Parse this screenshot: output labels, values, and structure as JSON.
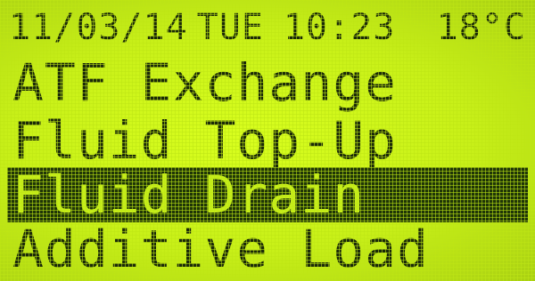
{
  "status_bar": {
    "date": "11/03/14",
    "weekday": "TUE",
    "time": "10:23",
    "temperature": "18°C"
  },
  "menu": {
    "items": [
      {
        "label": "ATF Exchange",
        "selected": false
      },
      {
        "label": "Fluid Top-Up",
        "selected": false
      },
      {
        "label": "Fluid Drain",
        "selected": true
      },
      {
        "label": "Additive Load",
        "selected": false
      }
    ]
  },
  "colors": {
    "lcd_background": "#c8f018",
    "text": "#1b2a08",
    "highlight_bar": "#1f3507"
  }
}
